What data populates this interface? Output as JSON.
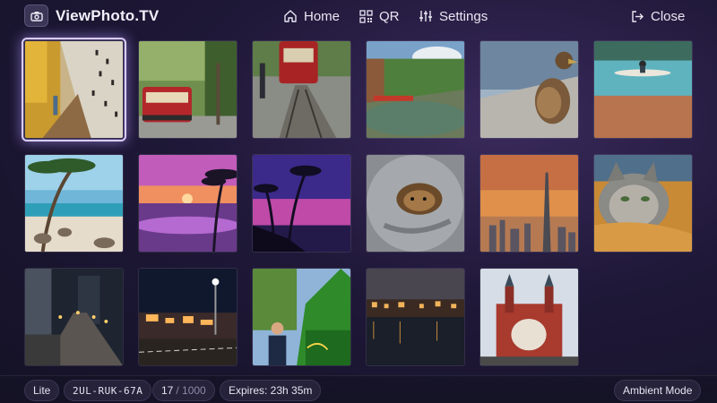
{
  "app": {
    "title": "ViewPhoto.TV"
  },
  "nav": {
    "home_label": "Home",
    "qr_label": "QR",
    "settings_label": "Settings",
    "close_label": "Close"
  },
  "gallery": {
    "selected_index": 0,
    "photos": [
      {
        "subject": "autumn walkway beside wall"
      },
      {
        "subject": "red tram on tree-lined street"
      },
      {
        "subject": "cable car on tracks"
      },
      {
        "subject": "canal with boats and trees"
      },
      {
        "subject": "duck on rock"
      },
      {
        "subject": "kayaker on lake"
      },
      {
        "subject": "tropical beach with palm"
      },
      {
        "subject": "purple sunset beach with palms"
      },
      {
        "subject": "palm trees at purple dusk"
      },
      {
        "subject": "yorkie in grey blanket"
      },
      {
        "subject": "city skyline at sunset"
      },
      {
        "subject": "tabby cat on knit blanket"
      },
      {
        "subject": "city street at night"
      },
      {
        "subject": "night town with street lamp"
      },
      {
        "subject": "man with green piano sculpture"
      },
      {
        "subject": "river city at night"
      },
      {
        "subject": "red brick railway station"
      }
    ]
  },
  "footer": {
    "plan": "Lite",
    "device_code": "2UL-RUK-67A",
    "count": "17",
    "total": "/ 1000",
    "expires": "Expires: 23h 35m",
    "ambient_label": "Ambient Mode"
  },
  "colors": {
    "accent_glow": "#b096ff",
    "background": "#1f1838"
  }
}
